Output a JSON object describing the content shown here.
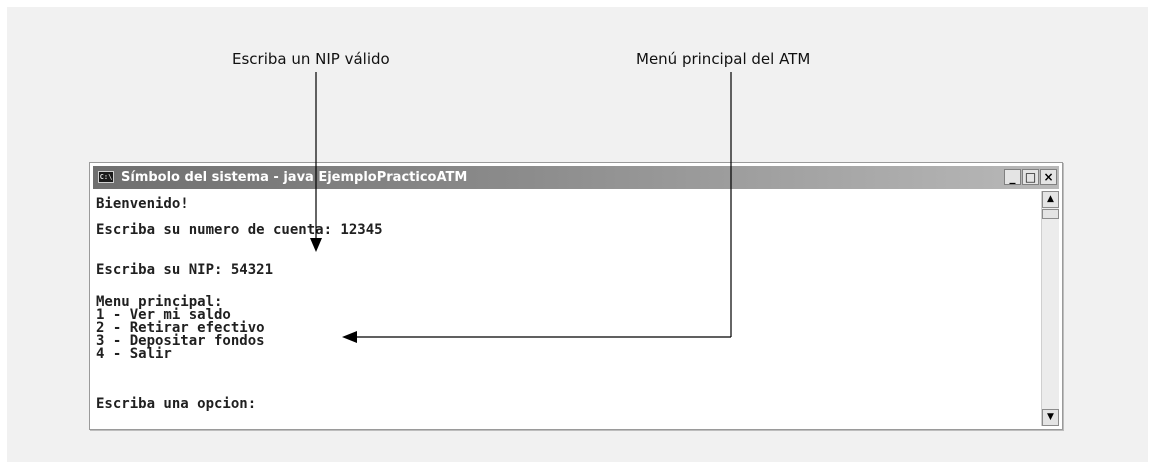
{
  "callouts": {
    "pin": "Escriba un NIP válido",
    "menu": "Menú principal del ATM"
  },
  "window": {
    "title": "Símbolo del sistema - java EjemploPracticoATM",
    "icon_text": "C:\\",
    "controls": {
      "minimize": "_",
      "maximize": "□",
      "close": "×"
    }
  },
  "console": {
    "lines": [
      "Bienvenido!",
      "Escriba su numero de cuenta: 12345",
      "Escriba su NIP: 54321",
      "Menu principal:",
      "1 - Ver mi saldo",
      "2 - Retirar efectivo",
      "3 - Depositar fondos",
      "4 - Salir",
      "Escriba una opcion:"
    ]
  },
  "scrollbar": {
    "up_icon": "▲",
    "down_icon": "▼"
  }
}
